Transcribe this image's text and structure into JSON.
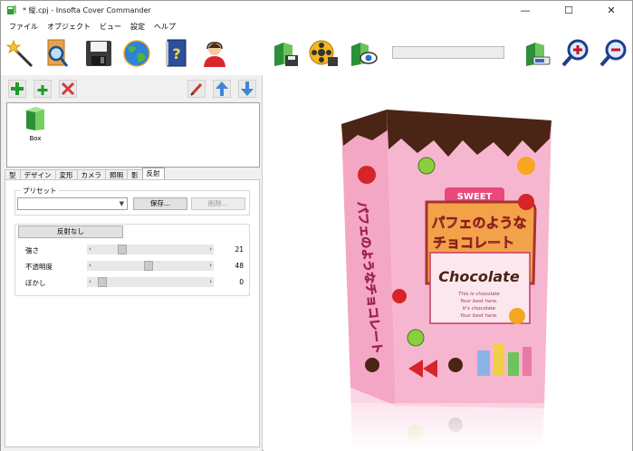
{
  "window": {
    "title": "* 縦.cpj - Insofta Cover Commander",
    "controls": {
      "minimize": "—",
      "maximize": "☐",
      "close": "✕"
    }
  },
  "menu": [
    "ファイル",
    "オブジェクト",
    "ビュー",
    "設定",
    "ヘルプ"
  ],
  "toolbar": {
    "buttons": [
      "wizard-icon",
      "open-folder-icon",
      "save-icon",
      "web-globe-icon",
      "help-book-icon",
      "support-agent-icon",
      "export-image-icon",
      "render-video-icon",
      "preview-eye-icon",
      "export-settings-icon",
      "zoom-in-icon",
      "zoom-out-icon"
    ],
    "search_value": ""
  },
  "object_toolbar": {
    "buttons": [
      "add-icon",
      "add-child-icon",
      "remove-icon",
      "edit-icon",
      "move-up-icon",
      "move-down-icon"
    ]
  },
  "objects": [
    {
      "label": "Box"
    }
  ],
  "tabs": [
    "型",
    "デザイン",
    "変形",
    "カメラ",
    "照明",
    "影",
    "反射"
  ],
  "active_tab": "反射",
  "preset": {
    "title": "プリセット",
    "selected": "",
    "save_label": "保存...",
    "delete_label": "削除..."
  },
  "reflection": {
    "no_reflection_label": "反射なし",
    "sliders": [
      {
        "label": "強さ",
        "value": "21",
        "fraction": 0.21
      },
      {
        "label": "不透明度",
        "value": "48",
        "fraction": 0.48
      },
      {
        "label": "ぼかし",
        "value": "0",
        "fraction": 0.0
      }
    ]
  },
  "preview": {
    "sign": "SWEET",
    "title_line1": "パフェのような",
    "title_line2": "チョコレート",
    "brand": "Chocolate",
    "tagline_lines": [
      "This is chocolate",
      "Your best here.",
      "It's chocolate",
      "Your best here."
    ],
    "side_text": "パフェのようなチョコレート"
  }
}
